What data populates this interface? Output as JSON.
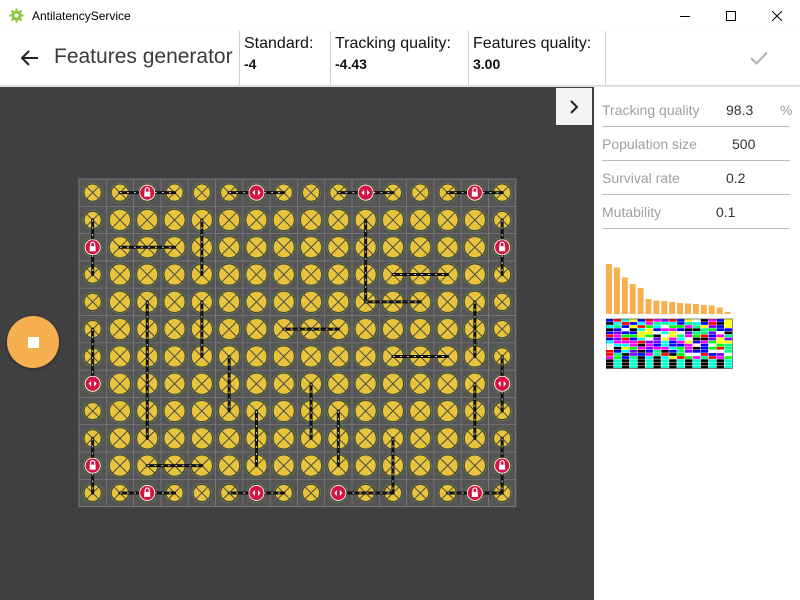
{
  "window": {
    "app_title": "AntilatencyService"
  },
  "header": {
    "title": "Features generator",
    "metrics": [
      {
        "label": "Standard:",
        "value": "-4"
      },
      {
        "label": "Tracking quality:",
        "value": "-4.43"
      },
      {
        "label": "Features quality:",
        "value": "3.00"
      }
    ]
  },
  "panel": {
    "tracking_quality": {
      "label": "Tracking quality",
      "value": "98.3",
      "unit": "%"
    },
    "population_size": {
      "label": "Population size",
      "value": "500"
    },
    "survival_rate": {
      "label": "Survival rate",
      "value": "0.2"
    },
    "mutability": {
      "label": "Mutability",
      "value": "0.1"
    },
    "histogram_values": [
      1.0,
      0.93,
      0.73,
      0.6,
      0.52,
      0.3,
      0.27,
      0.26,
      0.24,
      0.22,
      0.21,
      0.2,
      0.18,
      0.17,
      0.13,
      0.04
    ]
  },
  "icons": {
    "app": "gear-icon",
    "back": "arrow-left-icon",
    "confirm": "checkmark-icon",
    "expand": "chevron-right-icon",
    "stop": "stop-icon"
  },
  "colors": {
    "accent": "#f6b04f",
    "canvas_bg": "#404040",
    "tile_yellow": "#e7c43b",
    "marker_red": "#d31446"
  }
}
